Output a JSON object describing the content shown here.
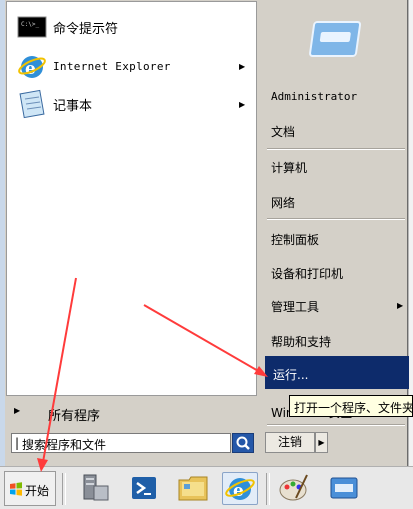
{
  "start_menu": {
    "programs": [
      {
        "label": "命令提示符",
        "icon": "command-prompt-icon",
        "has_submenu": false
      },
      {
        "label": "Internet Explorer",
        "icon": "internet-explorer-icon",
        "has_submenu": true
      },
      {
        "label": "记事本",
        "icon": "notepad-icon",
        "has_submenu": true
      }
    ],
    "all_programs": "所有程序",
    "search": {
      "placeholder": "搜索程序和文件"
    },
    "right_items": {
      "user": "Administrator",
      "documents": "文档",
      "computer": "计算机",
      "network": "网络",
      "control_panel": "控制面板",
      "devices": "设备和打印机",
      "admin_tools": "管理工具",
      "help": "帮助和支持",
      "run": "运行...",
      "security": "Windows 安全"
    },
    "shutdown": "注销",
    "tooltip": "打开一个程序、文件夹"
  },
  "taskbar": {
    "start_label": "开始",
    "pinned": [
      "server-manager-icon",
      "powershell-icon",
      "explorer-folder-icon",
      "internet-explorer-icon",
      "paint-icon",
      "remote-desktop-icon"
    ]
  },
  "colors": {
    "highlight": "#0d2b6b",
    "annotation_arrow": "#ff3b3b",
    "menu_bg": "#d4d0c8"
  }
}
